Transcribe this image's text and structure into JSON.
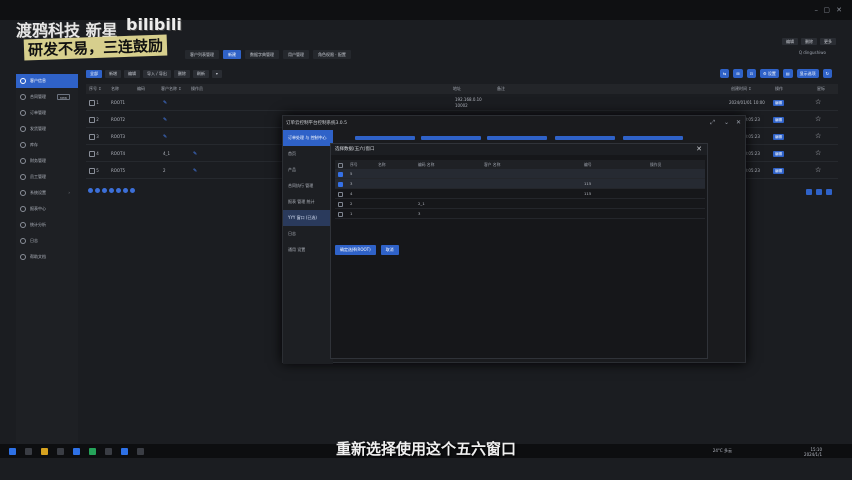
{
  "window": {
    "minimize": "–",
    "maximize": "▢",
    "close": "✕"
  },
  "watermark": {
    "line1": "渡鸦科技 新星",
    "line2": "研发不易，三连鼓励",
    "bili": "bilibili"
  },
  "topright": {
    "btn1": "编辑",
    "btn2": "删除",
    "btn3": "更多",
    "search": "Q  dingushiwo"
  },
  "pageTabs": [
    "客户列表管理",
    "新建",
    "数据字典管理",
    "用户管理",
    "角色权限 · 配置"
  ],
  "sidebar": [
    {
      "label": "客户信息",
      "active": true
    },
    {
      "label": "合同管理",
      "badge": "new"
    },
    {
      "label": "订单管理"
    },
    {
      "label": "发货管理"
    },
    {
      "label": "库存"
    },
    {
      "label": "财务管理"
    },
    {
      "label": "员工管理"
    },
    {
      "label": "系统设置",
      "chevron": "›"
    },
    {
      "label": "报表中心"
    },
    {
      "label": "统计分析"
    },
    {
      "label": "日志"
    },
    {
      "label": "帮助文档"
    }
  ],
  "toolbar": [
    "全部",
    "新增",
    "编辑",
    "导入 / 导出",
    "删除",
    "刷新",
    "▾"
  ],
  "rightTools": [
    "⇆",
    "⊞",
    "⊡",
    "⚙ 设置",
    "▤",
    "显示选项",
    "↻"
  ],
  "table": {
    "headers": [
      "序号 ↕",
      "名称",
      "编码",
      "客户名称 ↕",
      "操作员",
      "",
      "地址",
      "备注",
      "",
      "",
      "创建时间 ↕",
      "操作",
      "星标"
    ],
    "rows": [
      {
        "id": "1",
        "name": "ROOT1",
        "code": "",
        "tag": "",
        "addr": "192.168.0.10\n10002",
        "time": "2024/01/01 10:00",
        "action": "编辑"
      },
      {
        "id": "2",
        "name": "ROOT2",
        "code": "",
        "tag": "",
        "addr": "",
        "time": "",
        "action": "编辑"
      },
      {
        "id": "3",
        "name": "ROOT3",
        "code": "",
        "tag": "",
        "addr": "",
        "time": "",
        "action": "编辑"
      },
      {
        "id": "4",
        "name": "ROOT4",
        "code": "4_1",
        "tag": "",
        "addr": "",
        "time": "",
        "action": "编辑"
      },
      {
        "id": "5",
        "name": "ROOT5",
        "code": "2",
        "tag": "",
        "addr": "",
        "time": "",
        "action": "编辑"
      }
    ],
    "rowTime": [
      "2024/01/01 10:00",
      "09-21 10:05:23",
      "09-21 10:05:23",
      "09-21 10:05:23",
      "09-21 10:05:23"
    ]
  },
  "overlay": {
    "title": "订单云控制平台控制系统3.0.5",
    "menu": [
      "订单处理 与 控制中心",
      "首页",
      "产品",
      "合同执行 管理",
      "报表 管理 统计",
      "YYY 窗口 (已选)",
      "日志",
      "通用 设置"
    ]
  },
  "dialog": {
    "title": "选择数据(五六)窗口",
    "close": "✕",
    "headers": [
      "",
      "序号",
      "名称",
      "编码 名称",
      "",
      "客户 名称",
      "",
      "",
      "编号",
      "",
      "操作员"
    ],
    "rows": [
      {
        "checked": true,
        "id": "5",
        "c1": "",
        "c2": "",
        "c3": ""
      },
      {
        "checked": true,
        "id": "3",
        "c1": "",
        "c2": "115",
        "c3": ""
      },
      {
        "checked": false,
        "id": "4",
        "c1": "",
        "c2": "115",
        "c3": ""
      },
      {
        "checked": false,
        "id": "2",
        "c1": "2_1",
        "c2": "",
        "c3": ""
      },
      {
        "checked": false,
        "id": "1",
        "c1": "3",
        "c2": "",
        "c3": ""
      }
    ],
    "btnConfirm": "确定选择(ROOT)",
    "btnCancel": "取消"
  },
  "subtitle": "重新选择使用这个五六窗口",
  "taskbar": {
    "weather": "24°C 多云",
    "time": "15:10",
    "date": "2024/1/1"
  }
}
